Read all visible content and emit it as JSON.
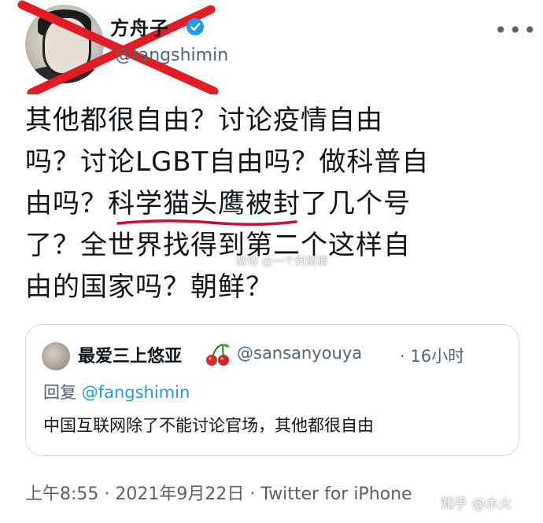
{
  "author": {
    "name": "方舟子",
    "handle": "@fangshimin",
    "avatar_icon": "portrait-avatar",
    "verified_icon": "verified-badge-icon",
    "verified_color": "#1d9bf0"
  },
  "more_label": "•••",
  "tweet": {
    "lines": [
      "其他都很自由？讨论疫情自由",
      "吗？讨论LGBT自由吗？做科普自",
      "由吗？科学猫头鹰被封了几个号",
      "了？全世界找得到第二个这样自",
      "由的国家吗？朝鲜？"
    ],
    "underline_color": "#c8102e"
  },
  "annotation": {
    "cross_color": "#e31b23"
  },
  "quote": {
    "name": "最爱三上悠亚",
    "emoji_icon": "cherry-icon",
    "handle": "@sansanyouya",
    "time": "· 16小时",
    "reply_prefix": "回复",
    "reply_handle": "@fangshimin",
    "text": "中国互联网除了不能讨论官场，其他都很自由"
  },
  "meta": {
    "text": "上午8:55 · 2021年9月22日 · Twitter for iPhone"
  },
  "watermarks": {
    "center": "微博 @一个刺猬猬",
    "corner": "知乎 @木火"
  }
}
